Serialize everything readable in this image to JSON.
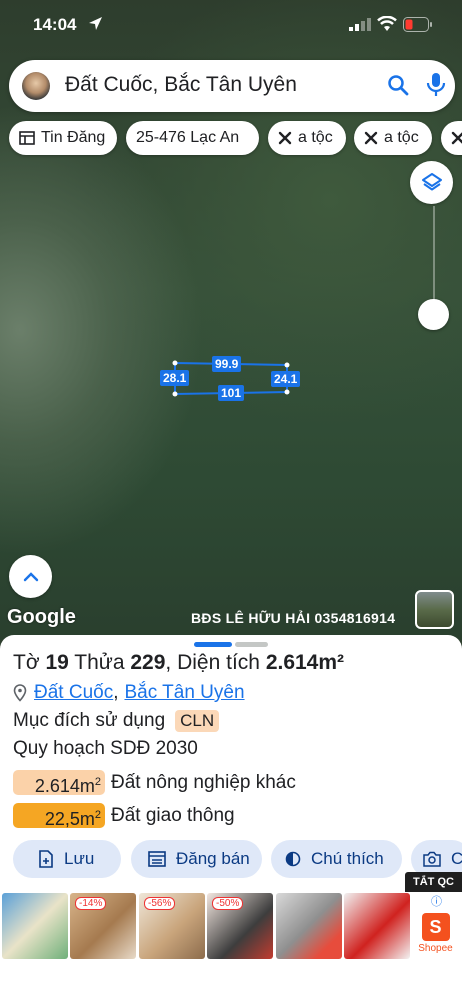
{
  "status": {
    "time": "14:04"
  },
  "search": {
    "query": "Đất Cuốc, Bắc Tân Uyên"
  },
  "chips": [
    {
      "label": "Tin Đăng",
      "icon": "table-icon"
    },
    {
      "label": "25-476 Lạc An",
      "icon": ""
    },
    {
      "label": "a tộc",
      "icon": "tools-icon"
    },
    {
      "label": "a tộc",
      "icon": "tools-icon"
    }
  ],
  "parcel": {
    "top": "99.9",
    "bottom": "101",
    "left": "28.1",
    "right": "24.1"
  },
  "map": {
    "google": "Google",
    "watermark": "BĐS LÊ HỮU HẢI 0354816914"
  },
  "sheet": {
    "title_prefix": "Tờ",
    "sheet_no": "19",
    "plot_prefix": "Thửa",
    "plot_no": "229",
    "area_prefix": "Diện tích",
    "area": "2.614m²",
    "location_1": "Đất Cuốc",
    "location_sep": ",",
    "location_2": "Bắc Tân Uyên",
    "purpose_label": "Mục đích sử dụng",
    "purpose_code": "CLN",
    "plan_label": "Quy hoạch SDĐ 2030",
    "areas": [
      {
        "value": "2.614m",
        "unit": "2",
        "label": "Đất nông nghiệp khác",
        "color": "#fbd2a9"
      },
      {
        "value": "22,5m",
        "unit": "2",
        "label": "Đất giao thông",
        "color": "#f5a623"
      }
    ]
  },
  "actions": [
    {
      "label": "Lưu",
      "icon": "save-icon"
    },
    {
      "label": "Đăng bán",
      "icon": "listing-icon"
    },
    {
      "label": "Chú thích",
      "icon": "contrast-icon"
    },
    {
      "label": "C",
      "icon": "camera-icon"
    }
  ],
  "ads": {
    "close_label": "TẮT QC",
    "tags": [
      "-14%",
      "-56%",
      "-50%"
    ],
    "shopee_label": "Shopee"
  }
}
